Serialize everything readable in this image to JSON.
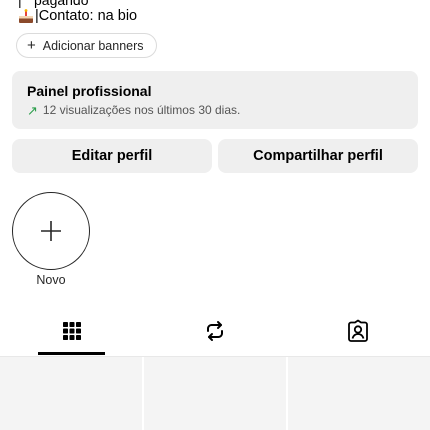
{
  "bio": {
    "cut_line": "pagando",
    "contact_line": "|Contato: na bio",
    "emoji_icon": "cake-icon"
  },
  "banner_chip": {
    "plus": "+",
    "label": "Adicionar banners"
  },
  "pro_panel": {
    "title": "Painel profissional",
    "trend_icon": "↗",
    "subtitle": "12 visualizações nos últimos 30 dias."
  },
  "actions": {
    "edit_label": "Editar perfil",
    "share_label": "Compartilhar perfil"
  },
  "stories": {
    "new_label": "Novo"
  },
  "tabs": [
    {
      "name": "grid",
      "icon": "grid-icon",
      "selected": true
    },
    {
      "name": "reels",
      "icon": "repost-icon",
      "selected": false
    },
    {
      "name": "tagged",
      "icon": "tagged-person-icon",
      "selected": false
    }
  ],
  "colors": {
    "panel_bg": "#efefef",
    "trend_green": "#2a9d4a",
    "indicator": "#000000"
  }
}
